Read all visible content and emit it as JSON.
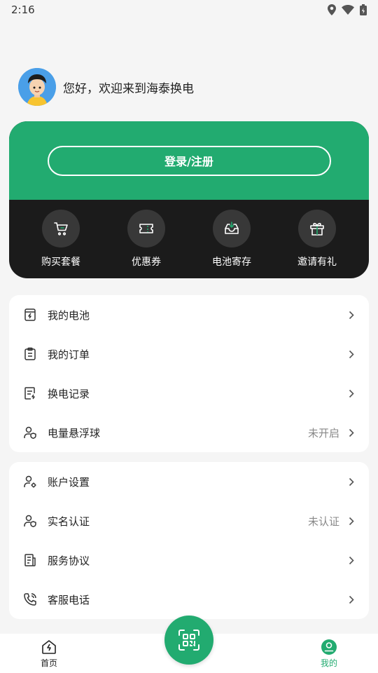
{
  "status_bar": {
    "time": "2:16"
  },
  "greeting": {
    "text": "您好，欢迎来到海泰换电"
  },
  "card": {
    "login_label": "登录/注册",
    "quick_actions": [
      {
        "label": "购买套餐",
        "icon": "cart-icon"
      },
      {
        "label": "优惠券",
        "icon": "coupon-icon"
      },
      {
        "label": "电池寄存",
        "icon": "inbox-download-icon"
      },
      {
        "label": "邀请有礼",
        "icon": "gift-icon"
      }
    ]
  },
  "menu_group_1": [
    {
      "label": "我的电池",
      "icon": "battery-icon",
      "status": ""
    },
    {
      "label": "我的订单",
      "icon": "clipboard-icon",
      "status": ""
    },
    {
      "label": "换电记录",
      "icon": "record-icon",
      "status": ""
    },
    {
      "label": "电量悬浮球",
      "icon": "user-shield-icon",
      "status": "未开启"
    }
  ],
  "menu_group_2": [
    {
      "label": "账户设置",
      "icon": "user-gear-icon",
      "status": ""
    },
    {
      "label": "实名认证",
      "icon": "user-shield-icon",
      "status": "未认证"
    },
    {
      "label": "服务协议",
      "icon": "document-icon",
      "status": ""
    },
    {
      "label": "客服电话",
      "icon": "phone-icon",
      "status": ""
    }
  ],
  "bottom_nav": {
    "home_label": "首页",
    "mine_label": "我的"
  },
  "colors": {
    "brand_green": "#22ab70",
    "dark_panel": "#1b1b1b"
  }
}
